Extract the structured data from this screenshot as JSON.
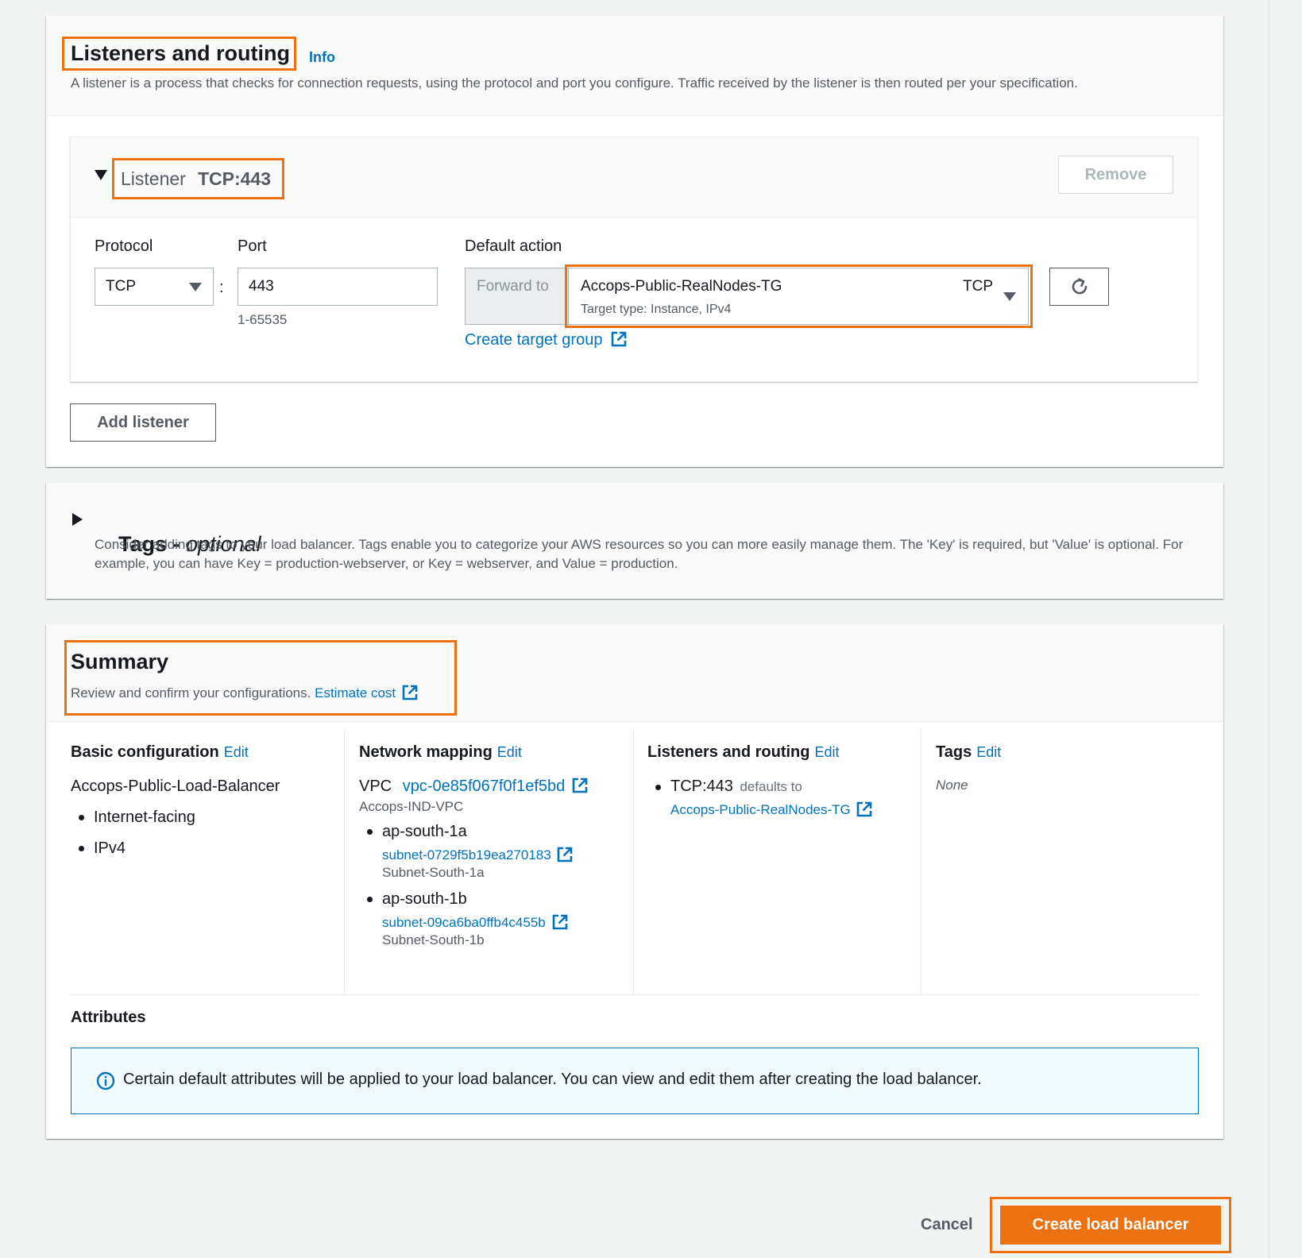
{
  "listeners": {
    "title": "Listeners and routing",
    "info": "Info",
    "description": "A listener is a process that checks for connection requests, using the protocol and port you configure. Traffic received by the listener is then routed per your specification.",
    "listener": {
      "label": "Listener",
      "name": "TCP:443",
      "remove": "Remove",
      "protocol_label": "Protocol",
      "protocol_value": "TCP",
      "port_label": "Port",
      "port_value": "443",
      "port_hint": "1-65535",
      "colon": ":",
      "default_action_label": "Default action",
      "forward_to": "Forward to",
      "target_group": "Accops-Public-RealNodes-TG",
      "target_protocol": "TCP",
      "target_type": "Target type: Instance, IPv4",
      "create_target_group": "Create target group"
    },
    "add_listener": "Add listener"
  },
  "tags": {
    "title": "Tags - ",
    "optional": "optional",
    "description": "Consider adding tags to your load balancer. Tags enable you to categorize your AWS resources so you can more easily manage them. The 'Key' is required, but 'Value' is optional. For example, you can have Key = production-webserver, or Key = webserver, and Value = production."
  },
  "summary": {
    "title": "Summary",
    "description": "Review and confirm your configurations.",
    "estimate_cost": "Estimate cost",
    "basic": {
      "title": "Basic configuration",
      "edit": "Edit",
      "name": "Accops-Public-Load-Balancer",
      "items": [
        "Internet-facing",
        "IPv4"
      ]
    },
    "network": {
      "title": "Network mapping",
      "edit": "Edit",
      "vpc_label": "VPC",
      "vpc_id": "vpc-0e85f067f0f1ef5bd",
      "vpc_name": "Accops-IND-VPC",
      "zones": [
        {
          "zone": "ap-south-1a",
          "subnet": "subnet-0729f5b19ea270183",
          "subnet_name": "Subnet-South-1a"
        },
        {
          "zone": "ap-south-1b",
          "subnet": "subnet-09ca6ba0ffb4c455b",
          "subnet_name": "Subnet-South-1b"
        }
      ]
    },
    "listeners": {
      "title": "Listeners and routing",
      "edit": "Edit",
      "listener": "TCP:443",
      "defaults_to": "defaults to",
      "target": "Accops-Public-RealNodes-TG"
    },
    "tags": {
      "title": "Tags",
      "edit": "Edit",
      "value": "None"
    },
    "attributes": {
      "title": "Attributes",
      "info": "Certain default attributes will be applied to your load balancer. You can view and edit them after creating the load balancer."
    }
  },
  "footer": {
    "cancel": "Cancel",
    "create": "Create load balancer"
  },
  "colors": {
    "accent": "#ec7211",
    "link": "#0073bb",
    "info_border": "#0073bb",
    "info_bg": "#f1faff"
  }
}
